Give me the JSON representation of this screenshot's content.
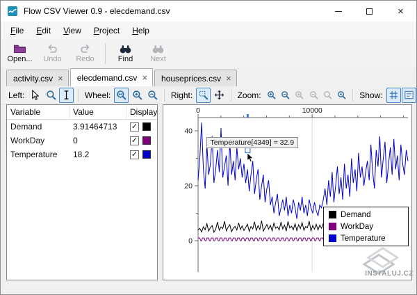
{
  "window": {
    "title": "Flow CSV Viewer 0.9 - elecdemand.csv",
    "controls": {
      "minimize": "",
      "maximize": "",
      "close": "×"
    }
  },
  "menu": {
    "items": [
      "File",
      "Edit",
      "View",
      "Project",
      "Help"
    ]
  },
  "toolbar": {
    "open": "Open...",
    "undo": "Undo",
    "redo": "Redo",
    "find": "Find",
    "next": "Next"
  },
  "tabs": [
    {
      "label": "activity.csv"
    },
    {
      "label": "elecdemand.csv"
    },
    {
      "label": "houseprices.csv"
    }
  ],
  "tab_close": "×",
  "chart_toolbar": {
    "left_label": "Left:",
    "wheel_label": "Wheel:",
    "right_label": "Right:",
    "zoom_label": "Zoom:",
    "show_label": "Show:"
  },
  "table": {
    "headers": [
      "Variable",
      "Value",
      "Display"
    ],
    "rows": [
      {
        "variable": "Demand",
        "value": "3.91464713",
        "checked": "✓",
        "color": "#000000"
      },
      {
        "variable": "WorkDay",
        "value": "0",
        "checked": "✓",
        "color": "#800080"
      },
      {
        "variable": "Temperature",
        "value": "18.2",
        "checked": "✓",
        "color": "#0000cc"
      }
    ]
  },
  "chart_data": {
    "type": "line",
    "x_axis": {
      "position": "top",
      "max": 18400,
      "minor_step": 2000,
      "major": [
        {
          "label": "0",
          "x": 0
        },
        {
          "label": "10000",
          "x": 10000
        }
      ],
      "gridlines": [
        10000
      ]
    },
    "y_axis": {
      "min_tick": 0,
      "max_tick": 40,
      "minor_step": 10,
      "major": [
        {
          "label": "0",
          "value": 0
        },
        {
          "label": "20",
          "value": 20
        },
        {
          "label": "40",
          "value": 40
        }
      ]
    },
    "series": [
      {
        "name": "WorkDay",
        "color": "#800080",
        "width": 1,
        "pattern": [
          1,
          1,
          1,
          0,
          0
        ],
        "repeat": 48
      },
      {
        "name": "Demand",
        "color": "#000000",
        "width": 1,
        "values": [
          3.9,
          4.5,
          3.2,
          5.1,
          4.0,
          6.2,
          3.5,
          4.8,
          5.5,
          3.1,
          4.2,
          6.8,
          3.8,
          5.0,
          4.4,
          7.1,
          3.6,
          4.9,
          5.8,
          3.3,
          4.6,
          5.2,
          3.9,
          6.5,
          4.1,
          5.4,
          3.7,
          4.8,
          6.0,
          3.4,
          5.2,
          4.3,
          6.9,
          3.8,
          5.5,
          4.1,
          7.3,
          3.5,
          4.7,
          5.9,
          4.2,
          5.6,
          3.6,
          6.4,
          4.5,
          5.1,
          3.9,
          6.8,
          4.3,
          5.7,
          3.5,
          7.0,
          4.6,
          5.3,
          4.0,
          6.2,
          3.7,
          5.8,
          4.4,
          6.6,
          3.8,
          5.2,
          4.7,
          7.2,
          3.6,
          5.5,
          4.2,
          6.0,
          3.9,
          5.7,
          4.5,
          6.3,
          3.8,
          7.5,
          4.2,
          5.9,
          4.8,
          8.2,
          3.7,
          6.1,
          5.0,
          8.8,
          4.1,
          6.7,
          5.3,
          9.4,
          3.9,
          7.2,
          5.6,
          10.1,
          4.3,
          7.8,
          5.1,
          9.0,
          4.6,
          8.4,
          5.2,
          9.8,
          4.4,
          7.6,
          5.8,
          10.5,
          4.0,
          8.0,
          6.2,
          9.2,
          4.7,
          7.4,
          5.4,
          8.6,
          4.2,
          6.9,
          5.9,
          9.6,
          4.5,
          8.3,
          5.0,
          7.7,
          4.8,
          6.4
        ]
      },
      {
        "name": "Temperature",
        "color": "#0000cc",
        "width": 1,
        "values": [
          22,
          30,
          43,
          26,
          19,
          35,
          24,
          28,
          38,
          21,
          26,
          33,
          25,
          41,
          23,
          27,
          31,
          20,
          36,
          24,
          29,
          22,
          34,
          26,
          30,
          23,
          28,
          21,
          26,
          18,
          24,
          29,
          17,
          22,
          26,
          15,
          20,
          24,
          14,
          19,
          22,
          13,
          16,
          10,
          14,
          17,
          9,
          12,
          15,
          11,
          16,
          9,
          13,
          10,
          15,
          12,
          8,
          14,
          11,
          16,
          10,
          13,
          9,
          15,
          12,
          10,
          14,
          11,
          9,
          13,
          12,
          15,
          19,
          13,
          22,
          16,
          25,
          14,
          20,
          27,
          17,
          23,
          15,
          28,
          19,
          24,
          16,
          30,
          21,
          26,
          18,
          32,
          23,
          27,
          20,
          25,
          29,
          22,
          35,
          25,
          19,
          33,
          27,
          38,
          23,
          30,
          36,
          21,
          28,
          34,
          24,
          37,
          26,
          31,
          22,
          35,
          28,
          24,
          33,
          29
        ]
      }
    ],
    "tooltip": {
      "text": "Temperature[4349] = 32.9",
      "x": 4349,
      "value": 32.9
    },
    "legend": {
      "position": "bottom-right",
      "entries": [
        {
          "label": "Demand",
          "color": "#000000"
        },
        {
          "label": "WorkDay",
          "color": "#800080"
        },
        {
          "label": "Temperature",
          "color": "#0000cc"
        }
      ]
    }
  },
  "watermark": {
    "text": "INSTALUJ.CZ"
  }
}
